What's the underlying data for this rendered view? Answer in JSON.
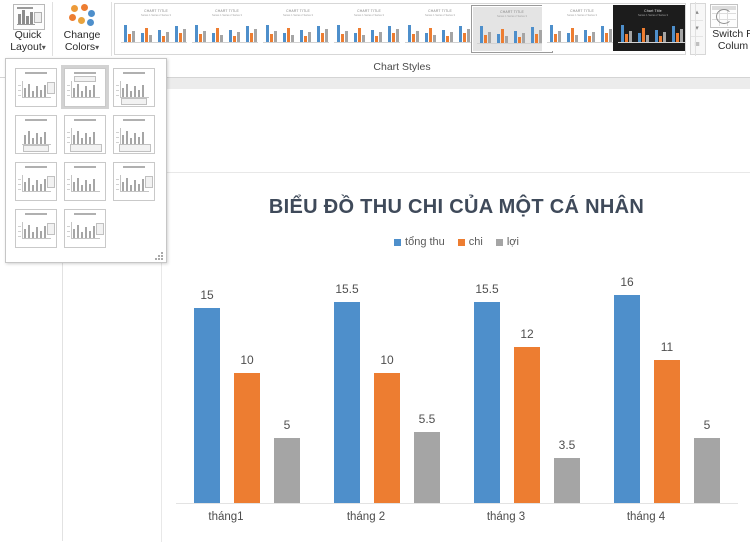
{
  "ribbon": {
    "cut_left_top": "t",
    "cut_left_bottom": "▾",
    "quick_layout": {
      "label_line1": "Quick",
      "label_line2": "Layout",
      "caret": "▾",
      "icon": "quick-layout-icon"
    },
    "change_colors": {
      "label_line1": "Change",
      "label_line2": "Colors",
      "caret": "▾",
      "icon": "change-colors-icon"
    },
    "chart_styles": {
      "group_label": "Chart Styles",
      "thumbnail_title": "CHART TITLE",
      "thumbnail_subtitle": "Series 1   Series 2   Series 3",
      "dark_thumbnail_title": "Chart Title",
      "scroll_up": "▴",
      "scroll_down": "▾",
      "more": "≣",
      "styles": [
        {
          "name": "style-1",
          "selected": false,
          "dark": false
        },
        {
          "name": "style-2",
          "selected": false,
          "dark": false
        },
        {
          "name": "style-3",
          "selected": false,
          "dark": false
        },
        {
          "name": "style-4",
          "selected": false,
          "dark": false
        },
        {
          "name": "style-5",
          "selected": false,
          "dark": false
        },
        {
          "name": "style-6",
          "selected": true,
          "dark": false
        },
        {
          "name": "style-7",
          "selected": false,
          "dark": false
        },
        {
          "name": "style-8",
          "selected": false,
          "dark": true
        }
      ]
    },
    "switch_row_column": {
      "label_line1": "Switch R",
      "label_line2": "Colum",
      "icon": "switch-row-column-icon"
    }
  },
  "quick_layout_gallery": {
    "selected_index": 1,
    "layouts": [
      {
        "name": "layout-1"
      },
      {
        "name": "layout-2"
      },
      {
        "name": "layout-3"
      },
      {
        "name": "layout-4"
      },
      {
        "name": "layout-5"
      },
      {
        "name": "layout-6"
      },
      {
        "name": "layout-7"
      },
      {
        "name": "layout-8"
      },
      {
        "name": "layout-9"
      },
      {
        "name": "layout-10"
      },
      {
        "name": "layout-11"
      }
    ]
  },
  "chart_data": {
    "type": "bar",
    "title": "BIỂU ĐỒ THU CHI CỦA MỘT CÁ NHÂN",
    "xlabel": "",
    "ylabel": "",
    "ylim": [
      0,
      18
    ],
    "grid": false,
    "legend_position": "top",
    "data_labels": true,
    "categories": [
      "tháng1",
      "tháng 2",
      "tháng 3",
      "tháng 4"
    ],
    "series": [
      {
        "name": "tổng thu",
        "color": "#4E8FCB",
        "values": [
          15,
          15.5,
          15.5,
          16
        ]
      },
      {
        "name": "chi",
        "color": "#ED7D31",
        "values": [
          10,
          10,
          12,
          11
        ]
      },
      {
        "name": "lợi",
        "color": "#A5A5A5",
        "values": [
          5,
          5.5,
          3.5,
          5
        ]
      }
    ]
  },
  "colors": {
    "series_blue": "#4E8FCB",
    "series_orange": "#ED7D31",
    "series_gray": "#A5A5A5",
    "title_text": "#3F4A5A"
  }
}
